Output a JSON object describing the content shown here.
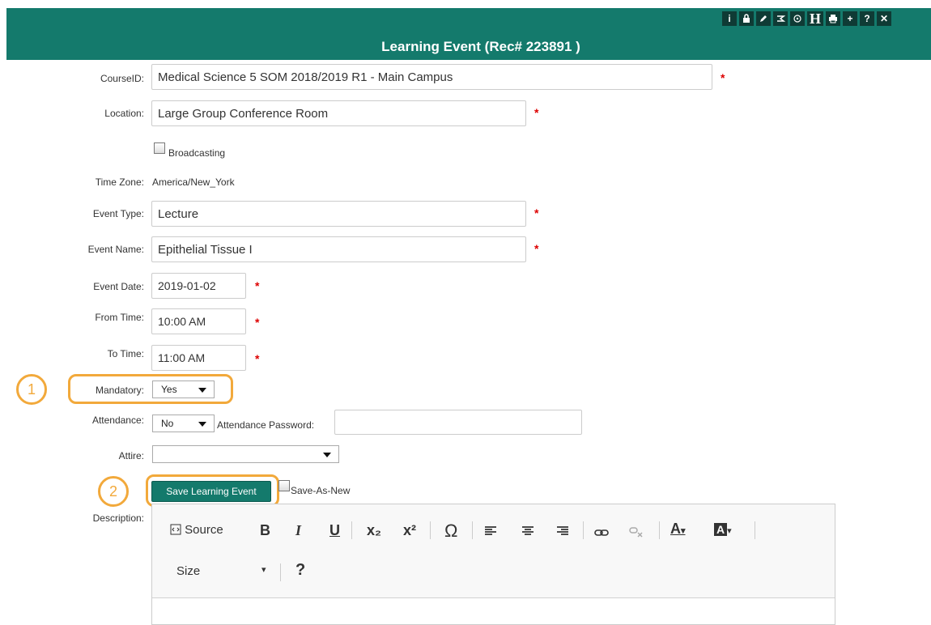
{
  "header": {
    "title": "Learning Event (Rec# 223891 )",
    "toolbar": [
      "i",
      "🔒",
      "✎",
      "⚖",
      "✥",
      "H",
      "🖶",
      "+",
      "?",
      "✕"
    ],
    "toolbar_icons": [
      "info-icon",
      "lock-icon",
      "edit-icon",
      "approve-icon",
      "move-icon",
      "heading-icon",
      "print-icon",
      "add-icon",
      "help-icon",
      "close-icon"
    ]
  },
  "form": {
    "course_label": "CourseID:",
    "course_value": "Medical Science 5 SOM 2018/2019 R1 - Main Campus",
    "location_label": "Location:",
    "location_value": "Large Group Conference Room",
    "broadcasting_label": "Broadcasting",
    "timezone_label": "Time Zone:",
    "timezone_value": "America/New_York",
    "event_type_label": "Event Type:",
    "event_type_value": "Lecture",
    "event_name_label": "Event Name:",
    "event_name_value": "Epithelial Tissue I",
    "event_date_label": "Event Date:",
    "event_date_value": "2019-01-02",
    "from_time_label": "From Time:",
    "from_time_value": "10:00 AM",
    "to_time_label": "To Time:",
    "to_time_value": "11:00 AM",
    "mandatory_label": "Mandatory:",
    "mandatory_value": "Yes",
    "attendance_label": "Attendance:",
    "attendance_value": "No",
    "attendance_password_label": "Attendance Password:",
    "attendance_password_value": "",
    "attire_label": "Attire:",
    "attire_value": "",
    "required_mark": "*",
    "save_button": "Save Learning Event",
    "save_as_new_label": "Save-As-New",
    "description_label": "Description:"
  },
  "callouts": {
    "one": "1",
    "two": "2"
  },
  "editor": {
    "source": "Source",
    "bold": "B",
    "italic": "I",
    "underline": "U",
    "subscript": "x₂",
    "superscript": "x²",
    "special_char": "Ω",
    "link": "⊖",
    "unlink": "⊗",
    "text_color": "A",
    "bg_color": "A",
    "size_label": "Size",
    "help": "?"
  },
  "colors": {
    "header": "#147a6c",
    "callout": "#f2a93b",
    "required": "#dd0000"
  }
}
